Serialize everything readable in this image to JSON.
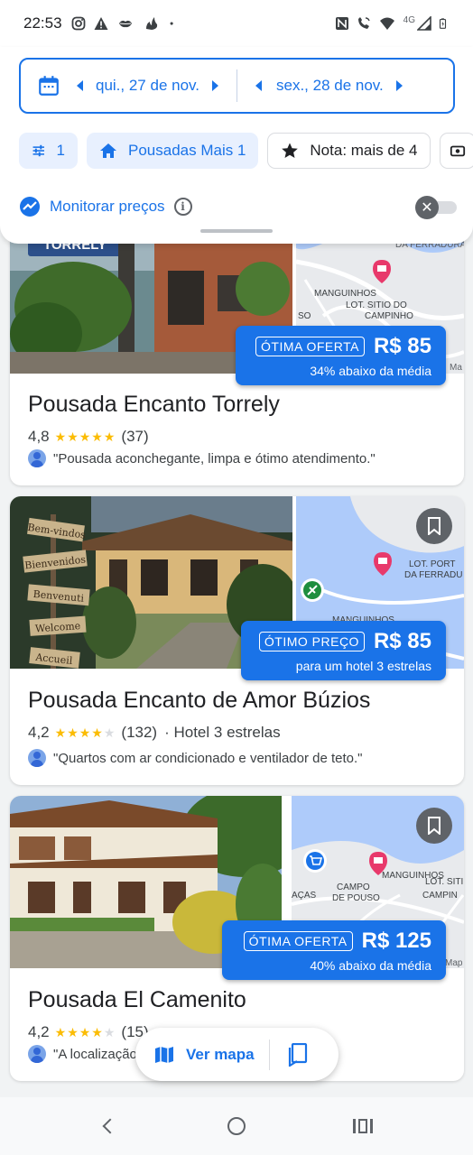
{
  "status_bar": {
    "time": "22:53",
    "icons_left": [
      "instagram-icon",
      "warning-icon",
      "lips-icon",
      "fire-icon",
      "dot-icon"
    ],
    "network": "4G",
    "icons_right": [
      "nfc-icon",
      "wifi-calling-icon",
      "wifi-icon",
      "signal-icon",
      "battery-icon"
    ]
  },
  "header": {
    "checkin": "qui., 27 de nov.",
    "checkout": "sex., 28 de nov.",
    "chips": {
      "filters_count": "1",
      "type": "Pousadas Mais 1",
      "rating": "Nota: mais de 4"
    },
    "monitor_label": "Monitorar preços",
    "info_glyph": "i",
    "toggle_glyph": "✕"
  },
  "colors": {
    "accent": "#1a73e8",
    "star": "#fbbc04"
  },
  "hotels": [
    {
      "name": "Pousada Encanto Torrely",
      "rating": "4,8",
      "reviews": "(37)",
      "star_count": 5,
      "hotel_class": "",
      "quote": "\"Pousada aconchegante, limpa e ótimo atendimento.\"",
      "badge_tag": "ÓTIMA OFERTA",
      "price": "R$ 85",
      "badge_sub": "34% abaixo da média",
      "sign_text": "TORRELY",
      "map_labels": [
        "DA FERRADURA",
        "MANGUINHOS",
        "LOT. SITIO DO",
        "CAMPINHO",
        "SO",
        "Ma"
      ]
    },
    {
      "name": "Pousada Encanto de Amor Búzios",
      "rating": "4,2",
      "reviews": "(132)",
      "star_count": 4,
      "hotel_class": "· Hotel 3 estrelas",
      "quote": "\"Quartos com ar condicionado e ventilador de teto.\"",
      "badge_tag": "ÓTIMO PREÇO",
      "price": "R$ 85",
      "badge_sub": "para um hotel 3 estrelas",
      "sign_texts": [
        "Bem-vindos",
        "Bienvenidos",
        "Benvenuti",
        "Welcome",
        "Accueil"
      ],
      "map_labels": [
        "LOT. PORT",
        "DA FERRADU",
        "MANGUINHOS"
      ]
    },
    {
      "name": "Pousada El Camenito",
      "rating": "4,2",
      "reviews": "(15)",
      "star_count": 4,
      "hotel_class": "",
      "quote": "\"A localização",
      "badge_tag": "ÓTIMA OFERTA",
      "price": "R$ 125",
      "badge_sub": "40% abaixo da média",
      "map_labels": [
        "MANGUINHOS",
        "CAMPO",
        "DE POUSO",
        "LOT. SITI",
        "CAMPIN",
        "AÇAS",
        "Map"
      ]
    }
  ],
  "fab": {
    "label": "Ver mapa"
  }
}
